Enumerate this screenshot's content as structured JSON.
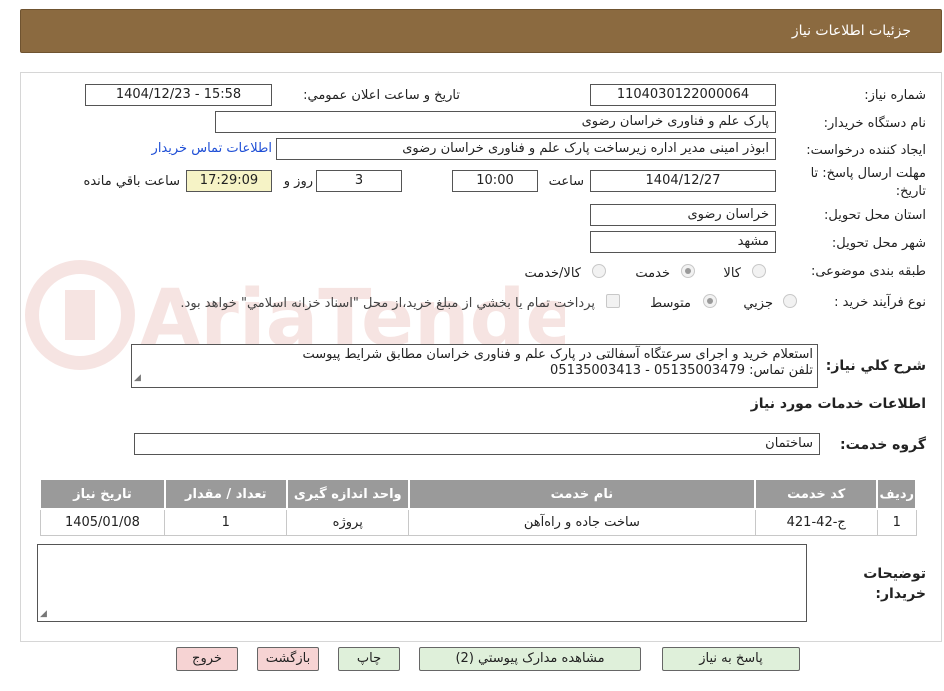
{
  "header": {
    "title": "جزئیات اطلاعات نیاز"
  },
  "fields": {
    "need_number_label": "شماره نیاز:",
    "need_number": "1104030122000064",
    "announce_label": "تاریخ و ساعت اعلان عمومي:",
    "announce_value": "1404/12/23 - 15:58",
    "buyer_org_label": "نام دستگاه خريدار:",
    "buyer_org": "پارک علم و فناوری خراسان رضوی",
    "requester_label": "ايجاد کننده درخواست:",
    "requester": "ابوذر امینی مدیر اداره زیرساخت پارک علم و فناوری خراسان رضوی",
    "buyer_contact_link": "اطلاعات تماس خريدار",
    "deadline_label_1": "مهلت ارسال پاسخ: تا",
    "deadline_label_2": "تاريخ:",
    "deadline_date": "1404/12/27",
    "time_label": "ساعت",
    "deadline_time": "10:00",
    "days_value": "3",
    "days_label": "روز و",
    "remaining_time": "17:29:09",
    "remaining_label": "ساعت باقي مانده",
    "province_label": "استان محل تحويل:",
    "province": "خراسان رضوی",
    "city_label": "شهر محل تحويل:",
    "city": "مشهد",
    "category_label": "طبقه بندی موضوعی:",
    "category_options": [
      "کالا",
      "خدمت",
      "کالا/خدمت"
    ],
    "category_selected": "خدمت",
    "process_label": "نوع فرآيند خريد :",
    "process_options": [
      "جزيي",
      "متوسط"
    ],
    "process_selected": "متوسط",
    "payment_note": "پرداخت تمام يا بخشي از مبلغ خريد،از محل \"اسناد خزانه اسلامي\" خواهد بود.",
    "description_label": "شرح کلي نياز:",
    "description_line1": "استعلام خرید و اجرای سرعتگاه آسفالتی در پارک علم و فناوری خراسان مطابق شرایط پیوست",
    "description_line2": "تلفن تماس: 05135003479 - 05135003413",
    "services_section_title": "اطلاعات خدمات مورد نياز",
    "service_group_label": "گروه خدمت:",
    "service_group": "ساختمان",
    "buyer_notes_label_1": "توضيحات",
    "buyer_notes_label_2": "خريدار:",
    "buyer_notes": ""
  },
  "table": {
    "headers": [
      "رديف",
      "کد خدمت",
      "نام خدمت",
      "واحد اندازه گيری",
      "تعداد / مقدار",
      "تاريخ نياز"
    ],
    "rows": [
      [
        "1",
        "ج-42-421",
        "ساخت جاده و راه‌آهن",
        "پروژه",
        "1",
        "1405/01/08"
      ]
    ]
  },
  "buttons": {
    "reply": "پاسخ به نياز",
    "attachments": "مشاهده مدارک پيوستي (2)",
    "print": "چاپ",
    "back": "بازگشت",
    "exit": "خروج"
  },
  "watermark": {
    "text": "AriaTender.neT"
  },
  "colors": {
    "header_bg": "#8b6a40",
    "link": "#1f4fd6",
    "remaining_bg": "#f6f3c6",
    "table_header_bg": "#9a9a9a"
  }
}
